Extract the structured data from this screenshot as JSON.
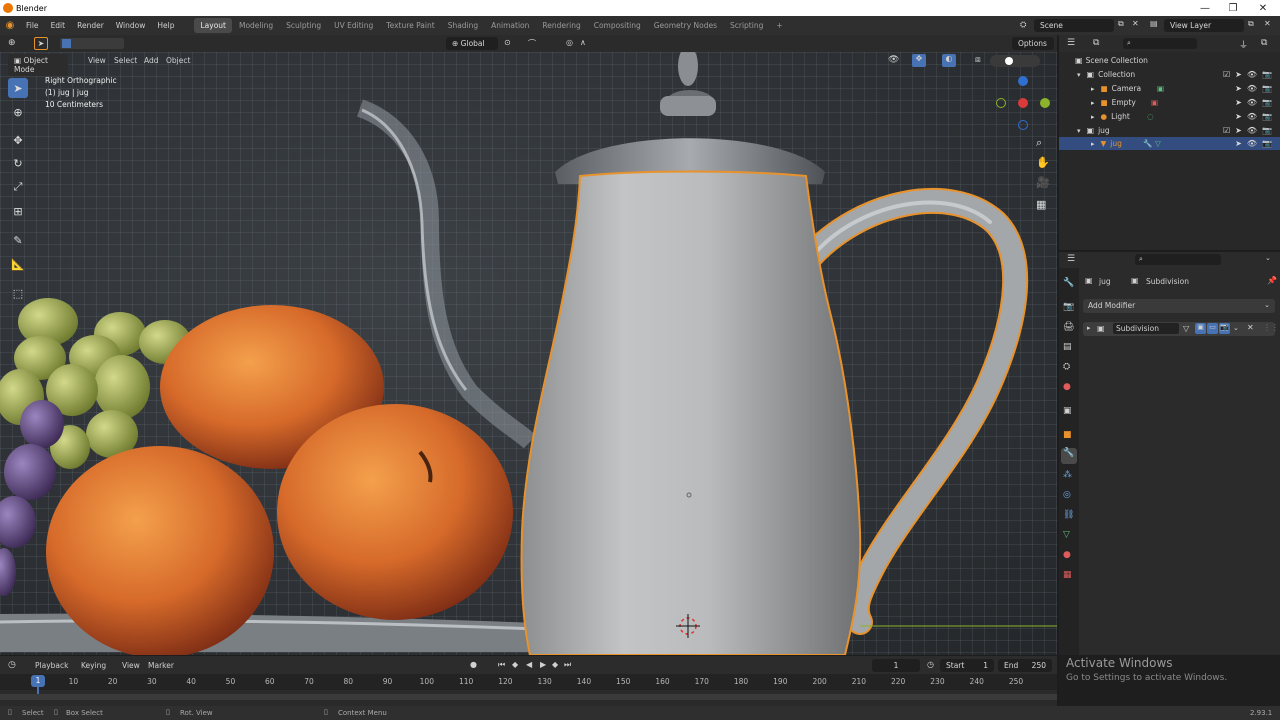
{
  "window": {
    "title": "Blender"
  },
  "menu": [
    "File",
    "Edit",
    "Render",
    "Window",
    "Help"
  ],
  "workspaces": [
    "Layout",
    "Modeling",
    "Sculpting",
    "UV Editing",
    "Texture Paint",
    "Shading",
    "Animation",
    "Rendering",
    "Compositing",
    "Geometry Nodes",
    "Scripting"
  ],
  "active_workspace": "Layout",
  "scene": {
    "name": "Scene",
    "view_layer": "View Layer"
  },
  "viewport_header": {
    "mode": "Object Mode",
    "menus": [
      "View",
      "Select",
      "Add",
      "Object"
    ],
    "orientation": "Global",
    "options": "Options"
  },
  "viewport_overlay": {
    "view_name": "Right Orthographic",
    "object_info": "(1) jug | jug",
    "grid_scale": "10 Centimeters"
  },
  "outliner": {
    "root": "Scene Collection",
    "items": [
      {
        "label": "Collection",
        "indent": 1
      },
      {
        "label": "Camera",
        "indent": 2
      },
      {
        "label": "Empty",
        "indent": 2
      },
      {
        "label": "Light",
        "indent": 2
      },
      {
        "label": "jug",
        "indent": 1
      },
      {
        "label": "jug",
        "indent": 2,
        "selected": true
      }
    ]
  },
  "properties": {
    "object_name": "jug",
    "modifier_tab": "Subdivision",
    "add_modifier": "Add Modifier",
    "modifier_name": "Subdivision"
  },
  "timeline": {
    "menus": [
      "Playback",
      "Keying",
      "View",
      "Marker"
    ],
    "current_frame": "1",
    "start_label": "Start",
    "start": "1",
    "end_label": "End",
    "end": "250",
    "ticks": [
      "10",
      "20",
      "30",
      "40",
      "50",
      "60",
      "70",
      "80",
      "90",
      "100",
      "110",
      "120",
      "130",
      "140",
      "150",
      "160",
      "170",
      "180",
      "190",
      "200",
      "210",
      "220",
      "230",
      "240",
      "250"
    ],
    "playhead": "1"
  },
  "statusbar": {
    "select": "Select",
    "box_select": "Box Select",
    "rotate_view": "Rot. View",
    "context_menu": "Context Menu",
    "version": "2.93.1"
  },
  "watermark": {
    "title": "Activate Windows",
    "subtitle": "Go to Settings to activate Windows."
  },
  "colors": {
    "accent": "#4772b3",
    "selection_outline": "#e8922c",
    "outliner_selected": "#334d80"
  }
}
